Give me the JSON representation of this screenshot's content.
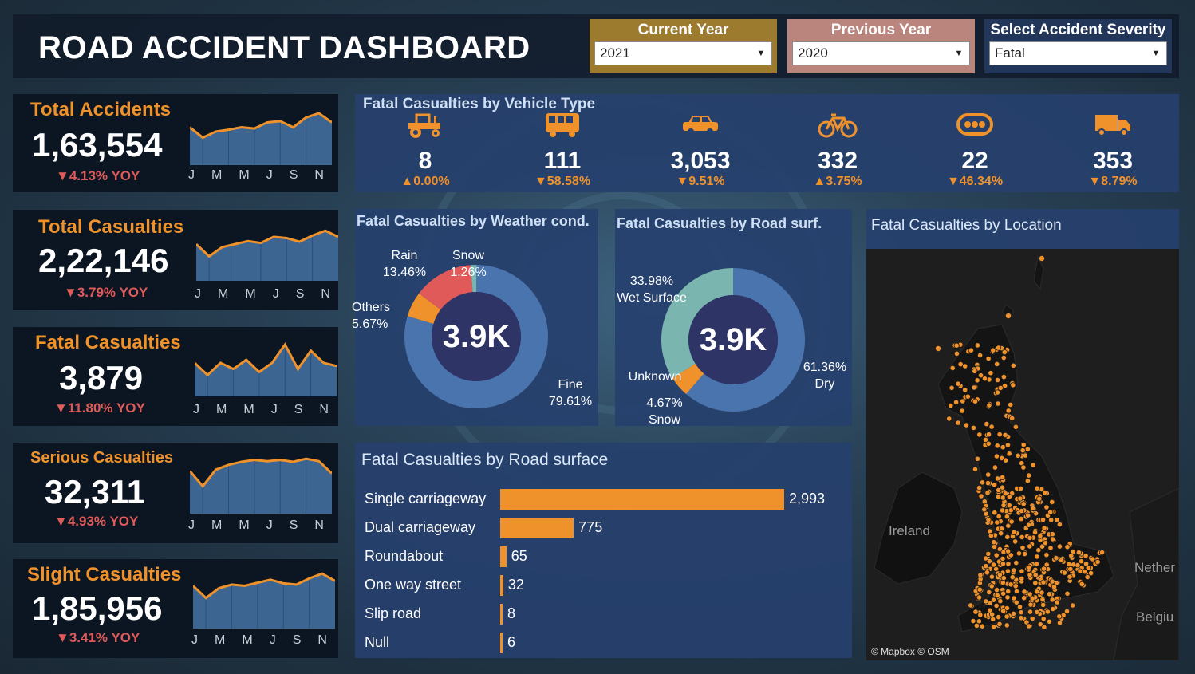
{
  "title": "ROAD ACCIDENT DASHBOARD",
  "filters": [
    {
      "label": "Current Year",
      "value": "2021",
      "color": "#9c7a2e",
      "label_color": "#ffffff"
    },
    {
      "label": "Previous Year",
      "value": "2020",
      "color": "#b9857c",
      "label_color": "#ffffff"
    },
    {
      "label": "Select Accident Severity",
      "value": "Fatal",
      "color": "#22365a",
      "label_color": "#ffffff"
    }
  ],
  "month_ticks": [
    "J",
    "M",
    "M",
    "J",
    "S",
    "N"
  ],
  "kpis": [
    {
      "title": "Total Accidents",
      "value": "1,63,554",
      "yoy": "▼4.13% YOY",
      "trend": [
        0.62,
        0.45,
        0.55,
        0.58,
        0.62,
        0.6,
        0.7,
        0.72,
        0.62,
        0.78,
        0.85,
        0.7
      ]
    },
    {
      "title": "Total Casualties",
      "value": "2,22,146",
      "yoy": "▼3.79% YOY",
      "trend": [
        0.6,
        0.4,
        0.55,
        0.6,
        0.65,
        0.62,
        0.72,
        0.7,
        0.64,
        0.74,
        0.82,
        0.72
      ]
    },
    {
      "title": "Fatal Casualties",
      "value": "3,879",
      "yoy": "▼11.80% YOY",
      "trend": [
        0.55,
        0.35,
        0.55,
        0.45,
        0.6,
        0.4,
        0.55,
        0.85,
        0.45,
        0.75,
        0.55,
        0.5
      ]
    },
    {
      "title": "Serious Casualties",
      "value": "32,311",
      "yoy": "▼4.93% YOY",
      "trend": [
        0.7,
        0.45,
        0.72,
        0.8,
        0.85,
        0.88,
        0.86,
        0.88,
        0.85,
        0.9,
        0.86,
        0.66
      ]
    },
    {
      "title": "Slight Casualties",
      "value": "1,85,956",
      "yoy": "▼3.41% YOY",
      "trend": [
        0.7,
        0.5,
        0.66,
        0.72,
        0.7,
        0.75,
        0.8,
        0.74,
        0.72,
        0.82,
        0.9,
        0.78
      ]
    }
  ],
  "vehicle_type": {
    "title": "Fatal Casualties by Vehicle Type",
    "items": [
      {
        "icon": "tractor-icon",
        "value": "8",
        "change": "▲0.00%"
      },
      {
        "icon": "bus-icon",
        "value": "111",
        "change": "▼58.58%"
      },
      {
        "icon": "car-icon",
        "value": "3,053",
        "change": "▼9.51%"
      },
      {
        "icon": "bicycle-icon",
        "value": "332",
        "change": "▲3.75%"
      },
      {
        "icon": "other-vehicle-icon",
        "value": "22",
        "change": "▼46.34%"
      },
      {
        "icon": "truck-icon",
        "value": "353",
        "change": "▼8.79%"
      }
    ]
  },
  "weather": {
    "title": "Fatal Casualties by Weather cond.",
    "center": "3.9K",
    "labels": {
      "rain_name": "Rain",
      "rain_pct": "13.46%",
      "snow_name": "Snow",
      "snow_pct": "1.26%",
      "others_name": "Others",
      "others_pct": "5.67%",
      "fine_name": "Fine",
      "fine_pct": "79.61%"
    },
    "slices": [
      {
        "name": "Fine",
        "pct": 79.61,
        "color": "#4a74ae"
      },
      {
        "name": "Others",
        "pct": 5.67,
        "color": "#f0922b"
      },
      {
        "name": "Rain",
        "pct": 13.46,
        "color": "#e05a5a"
      },
      {
        "name": "Snow",
        "pct": 1.26,
        "color": "#76b7b2"
      }
    ]
  },
  "road_surf": {
    "title": "Fatal Casualties by Road surf.",
    "center": "3.9K",
    "labels": {
      "wet_pct": "33.98%",
      "wet_name": "Wet Surface",
      "unknown_name": "Unknown",
      "snow_pct": "4.67%",
      "snow_name": "Snow",
      "dry_pct": "61.36%",
      "dry_name": "Dry"
    },
    "slices": [
      {
        "name": "Dry",
        "pct": 61.36,
        "color": "#4a74ae"
      },
      {
        "name": "Snow",
        "pct": 4.67,
        "color": "#f0922b"
      },
      {
        "name": "Wet Surface",
        "pct": 33.98,
        "color": "#7ab5b0"
      }
    ]
  },
  "road_type": {
    "title": "Fatal Casualties by Road surface",
    "rows": [
      {
        "label": "Single carriageway",
        "value": 2993,
        "display": "2,993"
      },
      {
        "label": "Dual carriageway",
        "value": 775,
        "display": "775"
      },
      {
        "label": "Roundabout",
        "value": 65,
        "display": "65"
      },
      {
        "label": "One way street",
        "value": 32,
        "display": "32"
      },
      {
        "label": "Slip road",
        "value": 8,
        "display": "8"
      },
      {
        "label": "Null",
        "value": 6,
        "display": "6"
      }
    ]
  },
  "location": {
    "title": "Fatal Casualties by Location",
    "labels": {
      "ireland": "Ireland",
      "netherlands": "Nether",
      "belgium": "Belgiu"
    },
    "credit": "© Mapbox © OSM"
  },
  "colors": {
    "accent": "#f0922b",
    "negative": "#e05a5a",
    "panel_blue": "#26406e",
    "panel_dark": "#0b1622"
  }
}
